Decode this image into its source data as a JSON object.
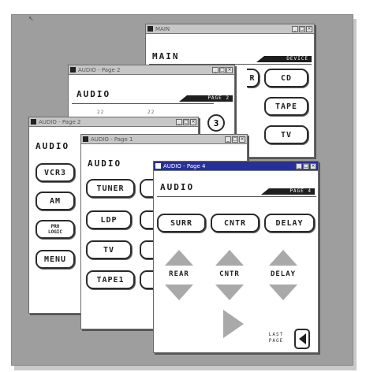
{
  "main_window": {
    "title": "MAIN",
    "heading": "MAIN",
    "pagebar": "DEVICE",
    "buttons": [
      "CD",
      "TAPE",
      "TV"
    ],
    "partial_button": "R"
  },
  "audio_page2": {
    "title": "AUDIO - Page 2",
    "heading": "AUDIO",
    "pagebar": "PAGE 2",
    "circle_button": "3",
    "fragments": [
      "22",
      "22"
    ]
  },
  "audio_page_left": {
    "title": "AUDIO - Page 2",
    "heading": "AUDIO",
    "buttons": [
      "VCR3",
      "AM",
      "MENU"
    ],
    "small_button_lines": [
      "PRO",
      "LOGIC"
    ]
  },
  "audio_page1": {
    "title": "AUDIO - Page 1",
    "heading": "AUDIO",
    "buttons": [
      "TUNER",
      "LDP",
      "TV",
      "TAPE1"
    ]
  },
  "audio_page4": {
    "title": "AUDIO - Page 4",
    "heading": "AUDIO",
    "pagebar": "PAGE 4",
    "buttons": [
      "SURR",
      "CNTR",
      "DELAY"
    ],
    "labels": [
      "REAR",
      "CNTR",
      "DELAY"
    ],
    "last_page_lines": [
      "LAST",
      "PAGE"
    ]
  },
  "titlebar_buttons": [
    "_",
    "□",
    "×"
  ],
  "colors": {
    "active_title": "#27309a",
    "inactive_title": "#c7c7c7",
    "backdrop": "#9e9e9e",
    "arrow": "#a9a9a9"
  }
}
